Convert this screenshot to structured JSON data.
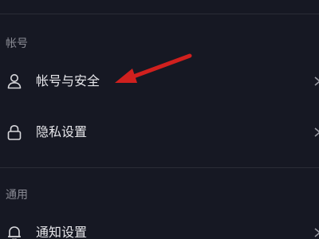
{
  "sections": [
    {
      "header": "帐号",
      "items": [
        {
          "label": "帐号与安全",
          "icon": "user-icon"
        },
        {
          "label": "隐私设置",
          "icon": "lock-icon"
        }
      ]
    },
    {
      "header": "通用",
      "items": [
        {
          "label": "通知设置",
          "icon": "bell-icon"
        }
      ]
    }
  ],
  "annotation": {
    "type": "arrow",
    "color": "#d0201e",
    "points_to": "帐号与安全"
  },
  "colors": {
    "background": "#161823",
    "divider": "#2a2c36",
    "section_header": "#8a8b94",
    "item_label": "#e6e6ea",
    "arrow": "#d0201e"
  }
}
